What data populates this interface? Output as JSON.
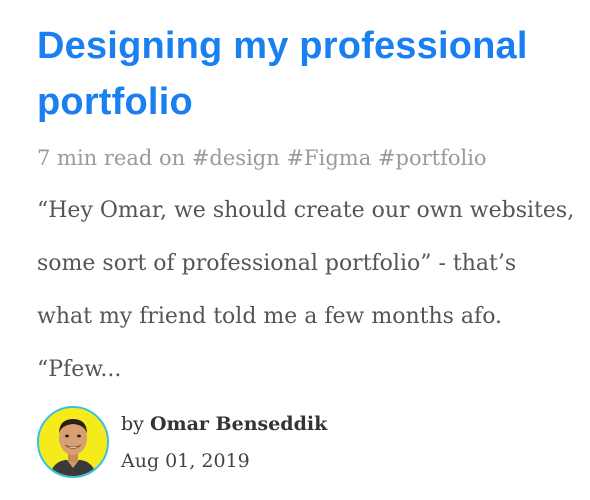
{
  "post": {
    "title": "Designing my professional portfolio",
    "read_time": "7 min read on",
    "tags": [
      "#design",
      "#Figma",
      "#portfolio"
    ],
    "excerpt": "“Hey Omar, we should create our own websites, some sort of professional portfolio” - that’s what my friend told me a few months afo. “Pfew...",
    "author_prefix": "by",
    "author_name": "Omar Benseddik",
    "date": "Aug 01, 2019"
  },
  "colors": {
    "title": "#1a7ff0",
    "meta": "#9a9a9a",
    "excerpt": "#555555",
    "avatar_bg": "#f5ea1a",
    "avatar_border": "#39c0e8"
  }
}
